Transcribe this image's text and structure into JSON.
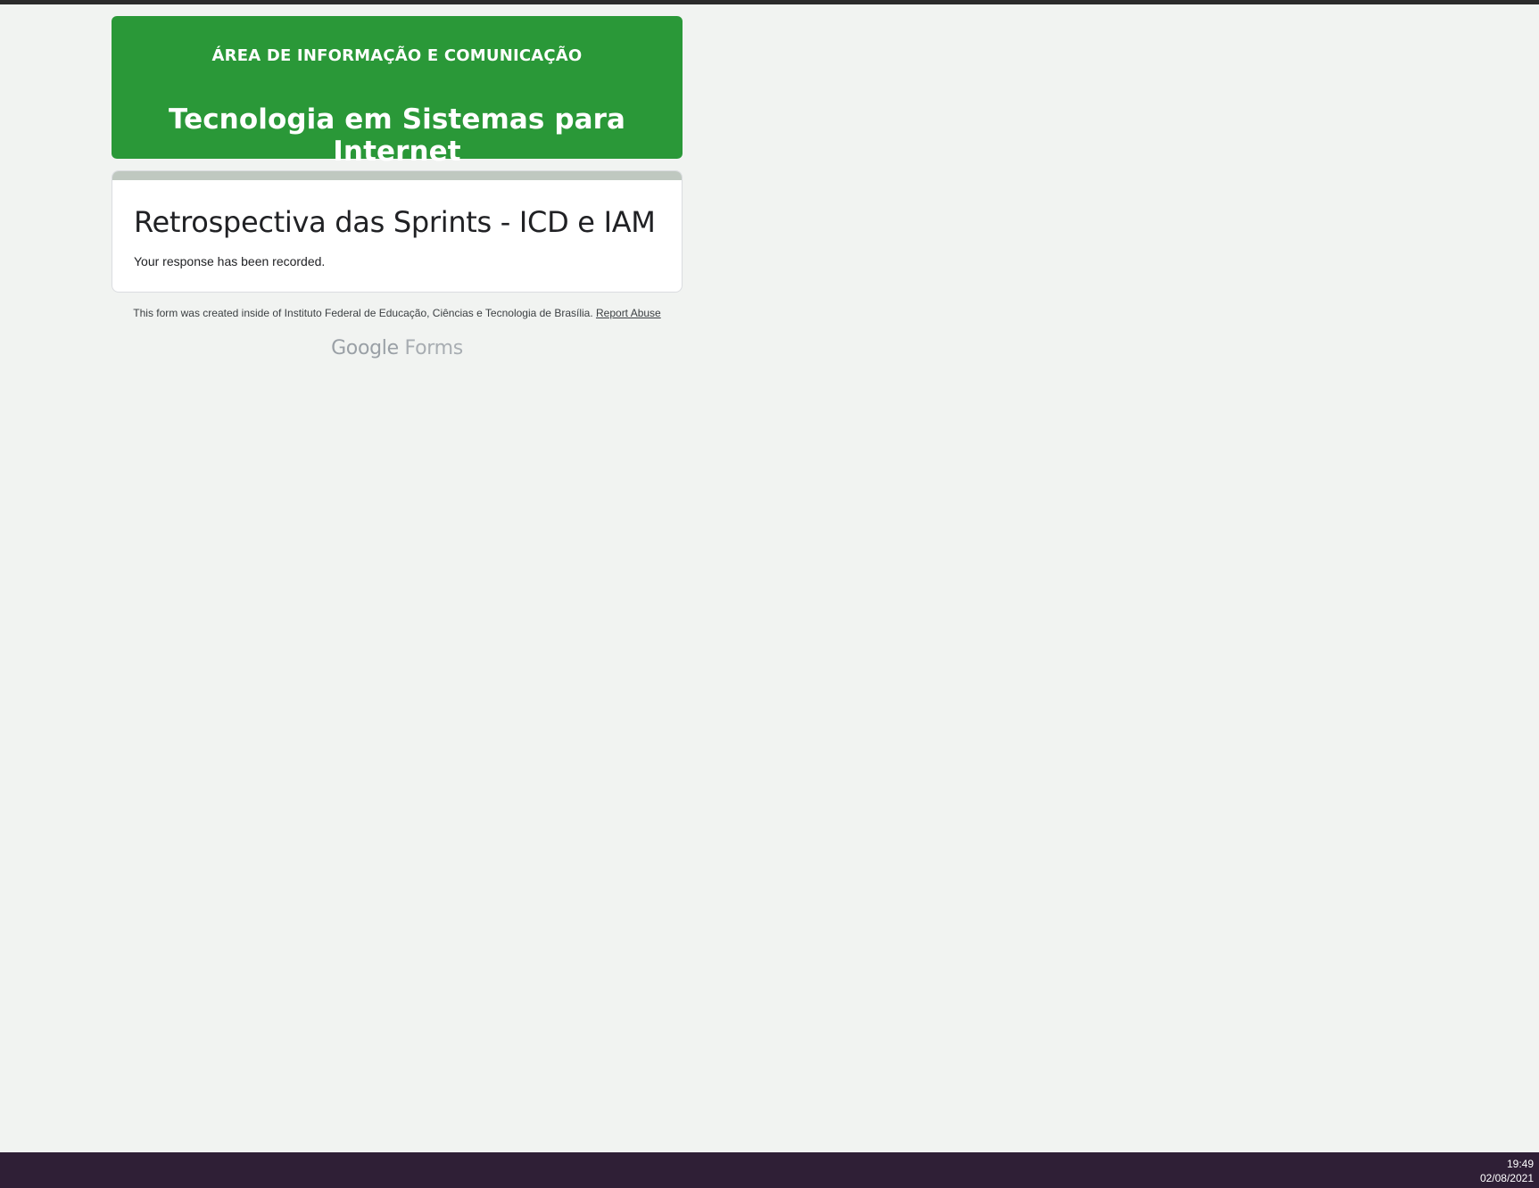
{
  "header": {
    "subtitle": "ÁREA DE INFORMAÇÃO E COMUNICAÇÃO",
    "title": "Tecnologia em Sistemas para Internet",
    "background_color": "#2a9838"
  },
  "form": {
    "title": "Retrospectiva das Sprints - ICD e IAM",
    "confirmation": "Your response has been recorded.",
    "accent_color": "#bfc8c0"
  },
  "footer": {
    "note": "This form was created inside of Instituto Federal de Educação, Ciências e Tecnologia de Brasília.",
    "report_link": "Report Abuse"
  },
  "brand": {
    "google": "Google",
    "forms": "Forms"
  },
  "taskbar": {
    "time": "19:49",
    "date": "02/08/2021",
    "background_color": "#2f1f36"
  }
}
